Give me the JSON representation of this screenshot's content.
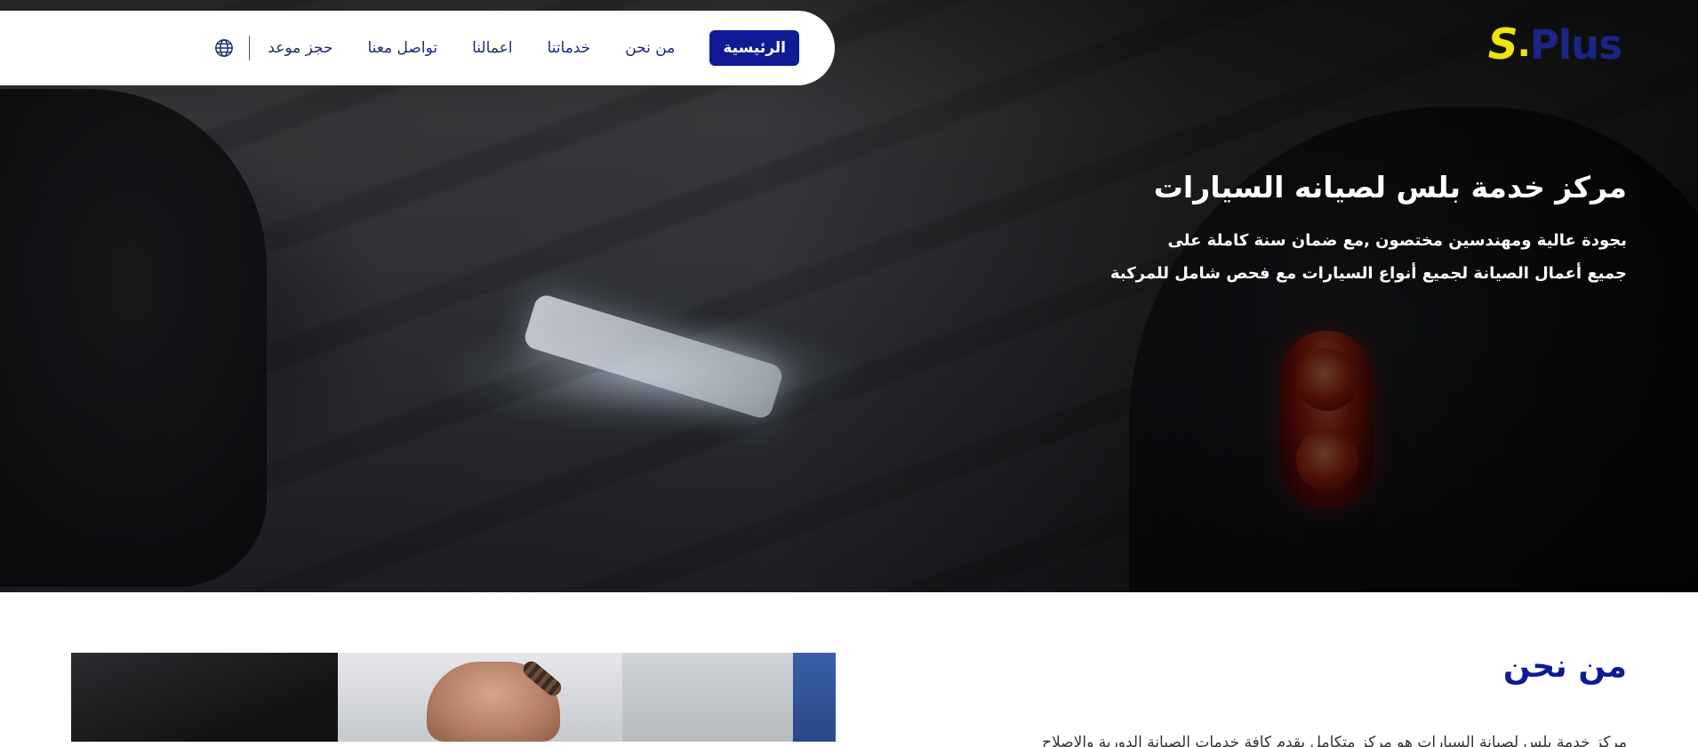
{
  "logo": {
    "mark": "S",
    "separator": ".",
    "word": "Plus"
  },
  "nav": {
    "items": [
      {
        "label": "الرئيسية",
        "active": true
      },
      {
        "label": "من نحن",
        "active": false
      },
      {
        "label": "خدماتنا",
        "active": false
      },
      {
        "label": "اعمالنا",
        "active": false
      },
      {
        "label": "تواصل معنا",
        "active": false
      },
      {
        "label": "حجز موعد",
        "active": false
      }
    ],
    "language_icon": "globe-icon"
  },
  "hero": {
    "title": "مركز خدمة بلس لصيانه السيارات",
    "description_line1": "بجودة عالية ومهندسين مختصون ,مع ضمان سنة كاملة على",
    "description_line2": "جميع أعمال الصيانة لجميع أنواع السيارات مع فحص شامل للمركبة"
  },
  "about": {
    "title": "من نحن",
    "body_visible": "مركز خدمة بلس لصيانة السيارات هو مركز متكامل يقدم كافة خدمات الصيانة الدورية والإصلاح"
  },
  "colors": {
    "brand_blue": "#0f1a94",
    "logo_yellow": "#f0e20e",
    "nav_text": "#1f2a7a"
  }
}
